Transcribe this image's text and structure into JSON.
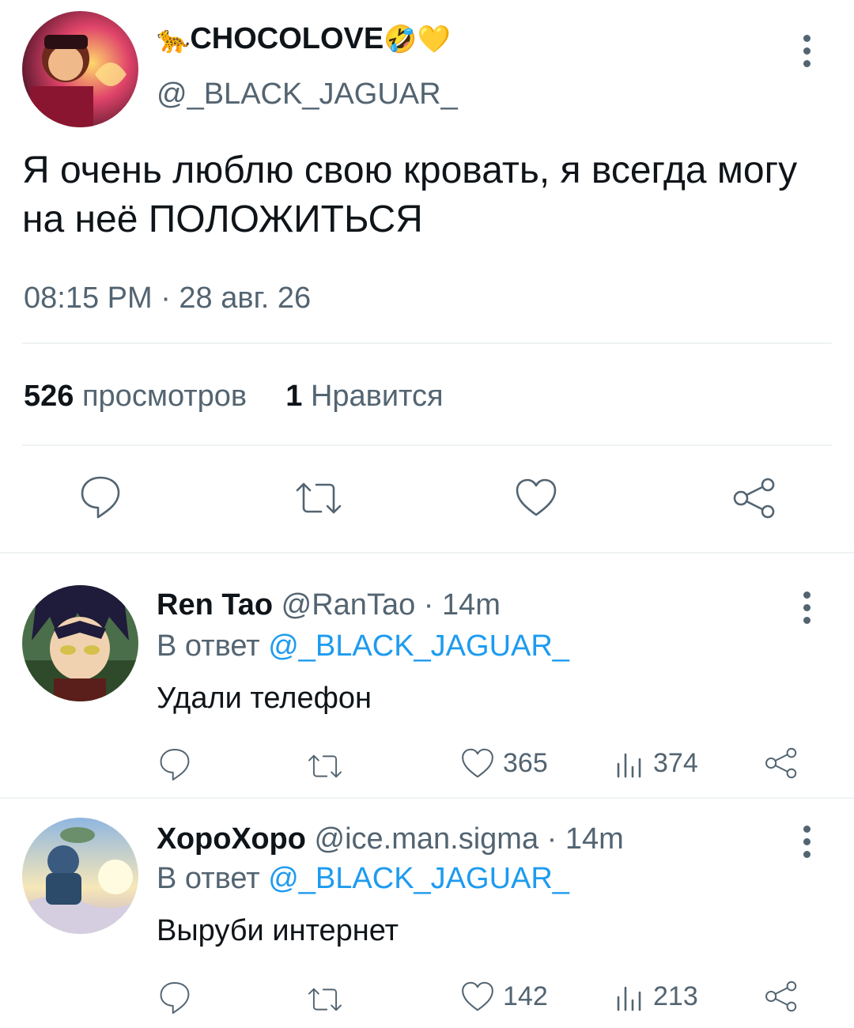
{
  "main_tweet": {
    "display_name": "CHOCOLOVE",
    "display_emoji": "🐆 🤣💛",
    "handle": "@_BLACK_JAGUAR_",
    "text": "Я очень люблю свою кровать, я всегда могу на неё ПОЛОЖИТЬСЯ",
    "timestamp": "08:15 PM · 28 авг. 26",
    "views_count": "526",
    "views_label": "просмотров",
    "likes_count": "1",
    "likes_label": "Нравится"
  },
  "replies": [
    {
      "display_name": "Ren Tao",
      "handle": "@RanTao",
      "time": "· 14m",
      "reply_prefix": "В ответ",
      "reply_to": "@_BLACK_JAGUAR_",
      "text": "Удали телефон",
      "likes": "365",
      "views": "374"
    },
    {
      "display_name": "ХороХоро",
      "handle": "@ice.man.sigma",
      "time": "· 14m",
      "reply_prefix": "В ответ",
      "reply_to": "@_BLACK_JAGUAR_",
      "text": "Выруби интернет",
      "likes": "142",
      "views": "213"
    }
  ],
  "colors": {
    "text": "#0f1419",
    "secondary": "#536471",
    "link": "#1d9bf0",
    "divider": "#eff3f4"
  },
  "icons": [
    "more-icon",
    "reply-icon",
    "retweet-icon",
    "like-icon",
    "share-icon",
    "views-icon"
  ]
}
